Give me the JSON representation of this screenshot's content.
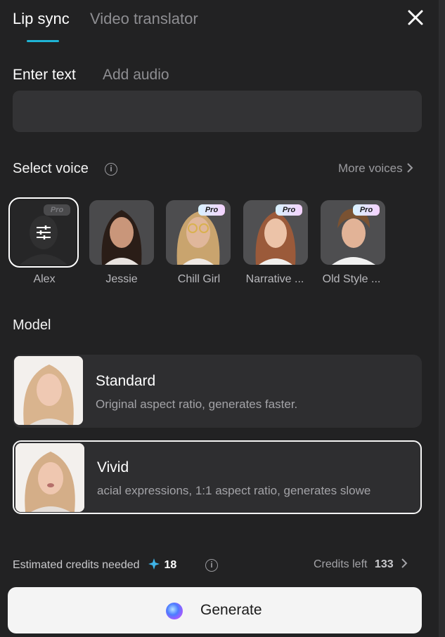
{
  "tabs": {
    "lip_sync": "Lip sync",
    "video_translator": "Video translator"
  },
  "input_tabs": {
    "enter_text": "Enter text",
    "add_audio": "Add audio"
  },
  "text_input": {
    "value": ""
  },
  "voice_section": {
    "title": "Select voice",
    "more_voices": "More voices",
    "voices": [
      {
        "name": "Alex",
        "pro": "Pro"
      },
      {
        "name": "Jessie"
      },
      {
        "name": "Chill Girl",
        "pro": "Pro"
      },
      {
        "name": "Narrative ...",
        "pro": "Pro"
      },
      {
        "name": "Old Style ...",
        "pro": "Pro"
      }
    ]
  },
  "model_section": {
    "title": "Model",
    "models": [
      {
        "title": "Standard",
        "description": "Original aspect ratio, generates faster."
      },
      {
        "title": "Vivid",
        "description": "acial expressions, 1:1 aspect ratio, generates slowe"
      }
    ]
  },
  "credits": {
    "estimated_label": "Estimated credits needed",
    "estimated_value": "18",
    "left_label": "Credits left",
    "left_value": "133"
  },
  "generate": {
    "label": "Generate"
  },
  "colors": {
    "accent": "#1fb5d6",
    "background": "#222223"
  }
}
